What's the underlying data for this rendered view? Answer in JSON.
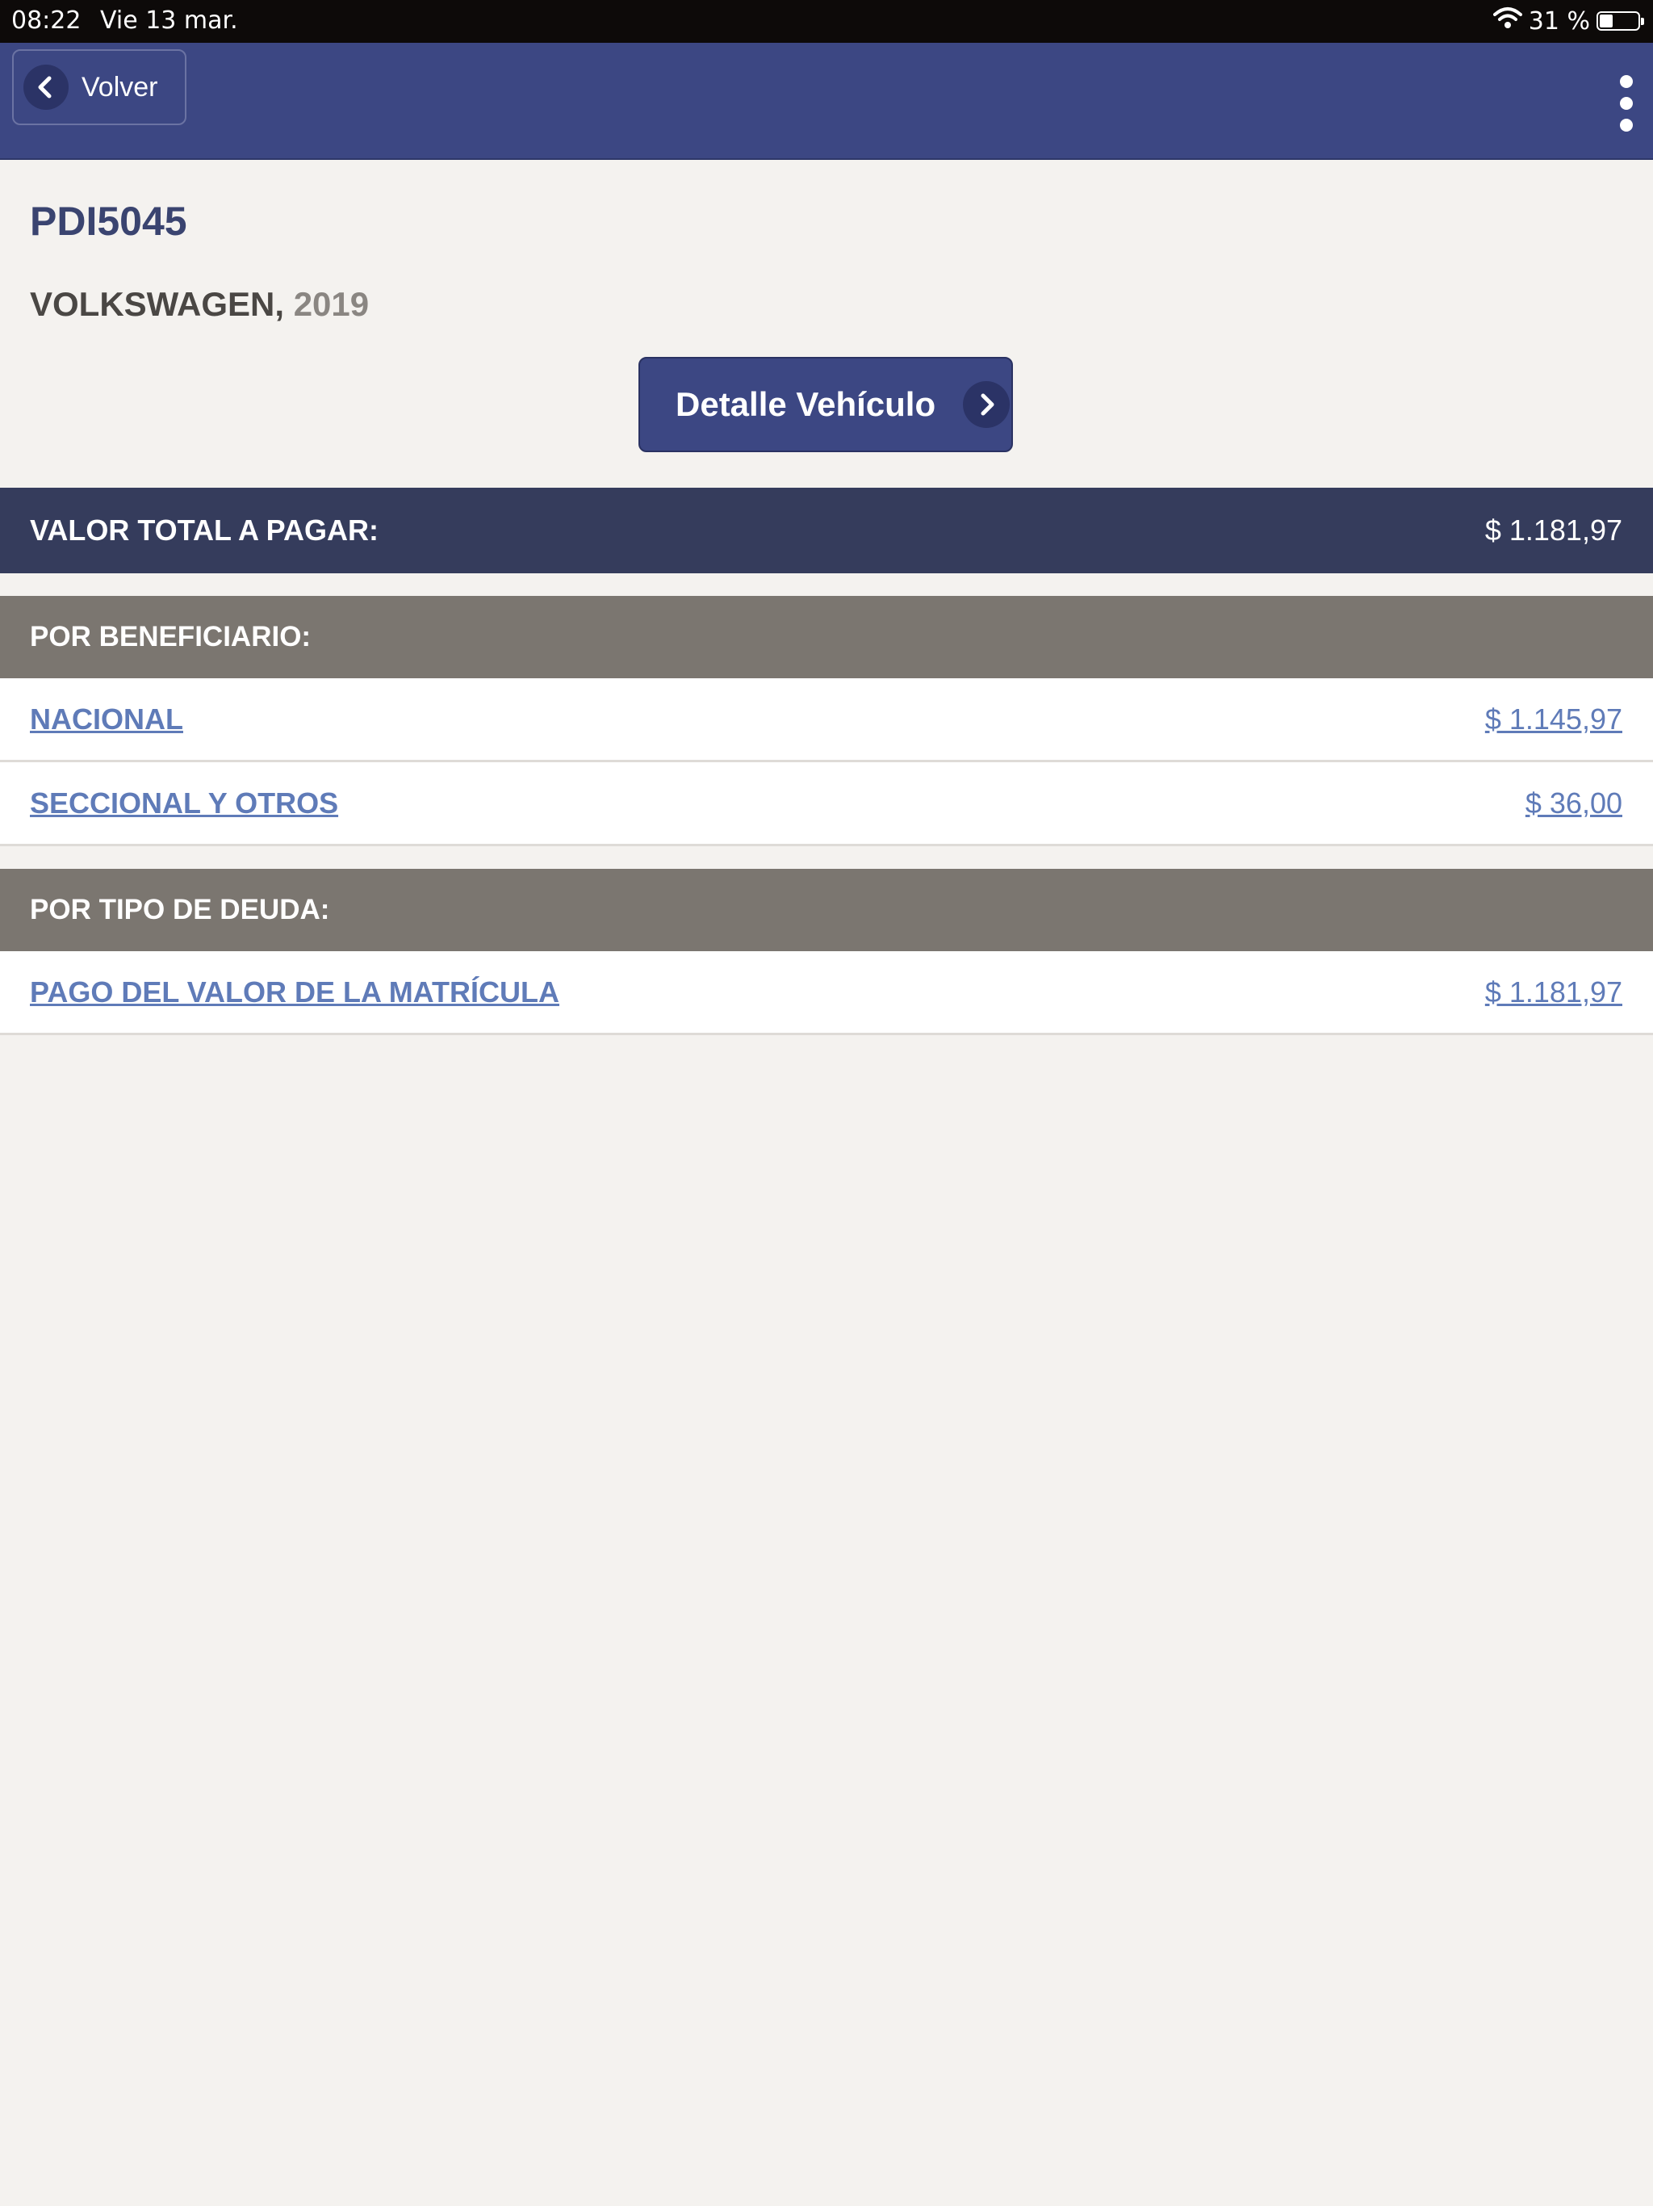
{
  "status_bar": {
    "time": "08:22",
    "date": "Vie 13 mar.",
    "battery_percent_text": "31 %",
    "battery_level": 0.31
  },
  "nav": {
    "back_label": "Volver"
  },
  "vehicle": {
    "plate": "PDI5045",
    "brand": "VOLKSWAGEN,",
    "year": "2019",
    "detail_button_label": "Detalle Vehículo"
  },
  "total": {
    "label": "VALOR TOTAL A PAGAR:",
    "amount": "$ 1.181,97"
  },
  "by_beneficiary": {
    "header": "POR BENEFICIARIO:",
    "items": [
      {
        "label": "NACIONAL",
        "amount": "$ 1.145,97"
      },
      {
        "label": "SECCIONAL Y OTROS",
        "amount": "$ 36,00"
      }
    ]
  },
  "by_debt_type": {
    "header": "POR TIPO DE DEUDA:",
    "items": [
      {
        "label": "PAGO DEL VALOR DE LA MATRÍCULA",
        "amount": "$ 1.181,97"
      }
    ]
  },
  "colors": {
    "nav_bg": "#3c4783",
    "total_bg": "#353c5c",
    "section_bg": "#7b7670",
    "link": "#5f7bb8"
  }
}
